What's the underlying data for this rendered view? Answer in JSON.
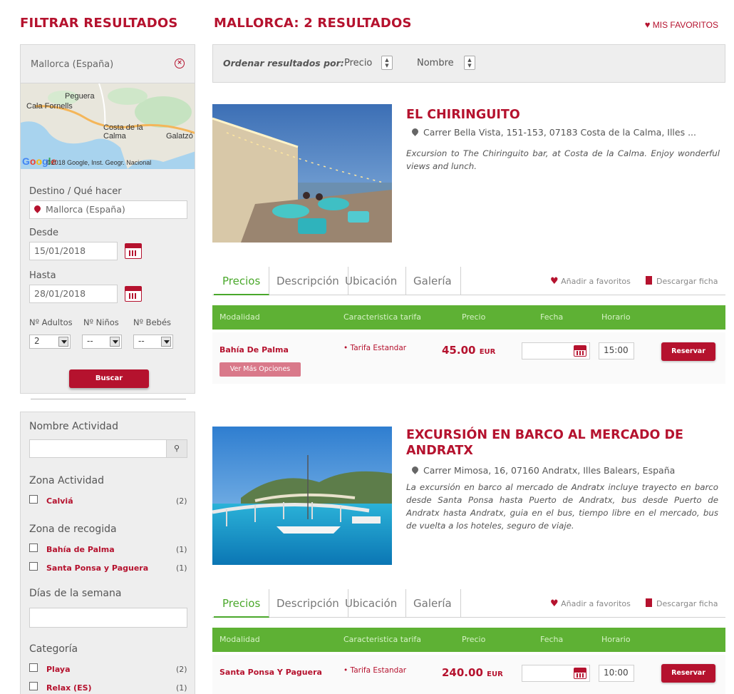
{
  "sidebar": {
    "heading": "FILTRAR RESULTADOS",
    "location": "Mallorca (España)",
    "map": {
      "labels": [
        "Peguera",
        "Cala Fornells",
        "Costa de la Calma",
        "Galatzó"
      ],
      "google": "Google",
      "copyright": "©2018 Google, Inst. Geogr. Nacional"
    },
    "destino_label": "Destino / Qué hacer",
    "destino_value": "Mallorca (España)",
    "desde_label": "Desde",
    "desde_value": "15/01/2018",
    "hasta_label": "Hasta",
    "hasta_value": "28/01/2018",
    "adultos_label": "Nº Adultos",
    "ninos_label": "Nº Niños",
    "bebes_label": "Nº Bebés",
    "adultos_value": "2",
    "ninos_value": "--",
    "bebes_value": "--",
    "search_button": "Buscar",
    "filters": {
      "nombre_label": "Nombre Actividad",
      "zona_actividad_label": "Zona Actividad",
      "zona_actividad_items": [
        {
          "label": "Calviá",
          "count": "(2)"
        }
      ],
      "zona_recogida_label": "Zona de recogida",
      "zona_recogida_items": [
        {
          "label": "Bahía de Palma",
          "count": "(1)"
        },
        {
          "label": "Santa Ponsa y Paguera",
          "count": "(1)"
        }
      ],
      "dias_label": "Días de la semana",
      "categoria_label": "Categoría",
      "categoria_items": [
        {
          "label": "Playa",
          "count": "(2)"
        },
        {
          "label": "Relax (ES)",
          "count": "(1)"
        }
      ]
    }
  },
  "main": {
    "heading": "MALLORCA: 2  RESULTADOS",
    "favorites": "MIS FAVORITOS",
    "sort_label": "Ordenar resultados por:",
    "sort_price": "Precio",
    "sort_name": "Nombre",
    "columns": [
      "Modalidad",
      "Caracteristica tarifa",
      "Precio",
      "Fecha",
      "Horario"
    ],
    "tabs": [
      "Precios",
      "Descripción",
      "Ubicación",
      "Galería"
    ],
    "add_fav": "Añadir a favoritos",
    "download": "Descargar ficha",
    "results": [
      {
        "title": "EL CHIRINGUITO",
        "address": "Carrer Bella Vista, 151-153, 07183 Costa de la Calma, Illes ...",
        "description": "Excursion to The Chiringuito bar, at Costa de la Calma. Enjoy wonderful views and lunch.",
        "modalidad": "Bahía De Palma",
        "tarifa": "• Tarifa Estandar",
        "price": "45.00",
        "currency": "EUR",
        "horario": "15:00",
        "reserve": "Reservar",
        "more": "Ver Más Opciones"
      },
      {
        "title": "EXCURSIÓN EN BARCO AL MERCADO DE ANDRATX",
        "address": "Carrer Mimosa, 16, 07160 Andratx, Illes Balears, España",
        "description": "La excursión en barco al mercado de Andratx incluye trayecto en barco desde Santa Ponsa hasta Puerto de Andratx, bus desde Puerto de Andratx hasta Andratx, guia en el bus, tiempo libre en el mercado, bus de vuelta a los hoteles, seguro de viaje.",
        "modalidad": "Santa Ponsa Y Paguera",
        "tarifa": "• Tarifa Estandar",
        "price": "240.00",
        "currency": "EUR",
        "horario": "10:00",
        "reserve": "Reservar"
      }
    ]
  }
}
